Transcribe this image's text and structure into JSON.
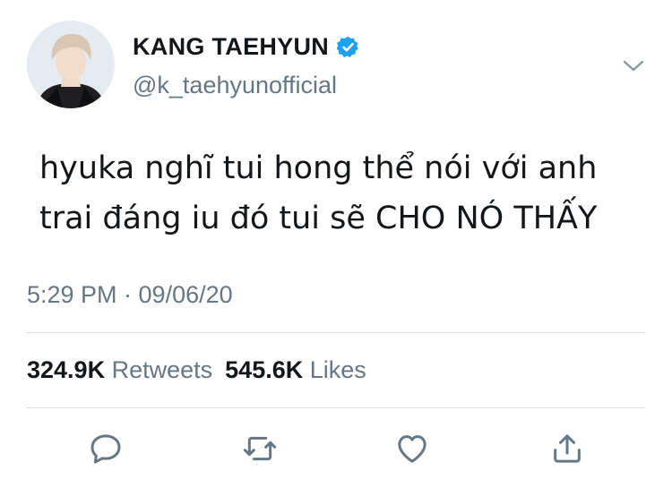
{
  "user": {
    "display_name": "KANG TAEHYUN",
    "handle": "@k_taehyunofficial",
    "verified": true,
    "avatar_icon": "avatar-photo"
  },
  "tweet": {
    "text_line1": "hyuka nghĩ tui hong thể nói với anh",
    "text_line2": "trai đáng iu đó tui sẽ CHO NÓ THẤY",
    "timestamp": "5:29 PM · 09/06/20"
  },
  "stats": {
    "retweets_count": "324.9K",
    "retweets_label": "Retweets",
    "likes_count": "545.6K",
    "likes_label": "Likes"
  },
  "actions": {
    "icons": [
      "reply-icon",
      "retweet-icon",
      "like-icon",
      "share-icon"
    ]
  },
  "colors": {
    "verified_blue": "#1da1f2",
    "secondary_text": "#657786",
    "icon_gray": "#657786",
    "divider": "#d8dfe4"
  }
}
